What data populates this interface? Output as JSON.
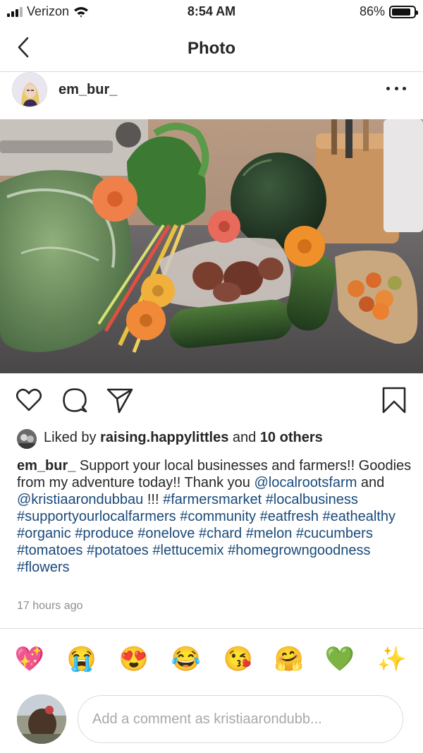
{
  "status": {
    "carrier": "Verizon",
    "time": "8:54 AM",
    "battery": "86%",
    "battery_level": 0.86
  },
  "nav": {
    "title": "Photo"
  },
  "post": {
    "username": "em_bur_",
    "likes": {
      "prefix": "Liked by ",
      "user": "raising.happylittles",
      "middle": " and ",
      "others": "10 others"
    },
    "caption": {
      "author": "em_bur_",
      "text1": " Support your local businesses and farmers!! Goodies from my adventure today!! Thank you ",
      "mention1": "@localrootsfarm",
      "text2": " and ",
      "mention2": "@kristiaarondubbau",
      "text3": " !!! ",
      "hashtags": [
        "#farmersmarket",
        "#localbusiness",
        "#supportyourlocalfarmers",
        "#community",
        "#eatfresh",
        "#eathealthy",
        "#organic",
        "#produce",
        "#onelove",
        "#chard",
        "#melon",
        "#cucumbers",
        "#tomatoes",
        "#potatoes",
        "#lettucemix",
        "#homegrowngoodness",
        "#flowers"
      ]
    },
    "timestamp": "17 hours ago"
  },
  "reactions": [
    "💖",
    "😭",
    "😍",
    "😂",
    "😘",
    "🤗",
    "💚",
    "✨"
  ],
  "comment": {
    "placeholder": "Add a comment as kristiaarondubb..."
  },
  "icons": {
    "back": "chevron-left-icon",
    "more": "more-horizontal-icon",
    "like": "heart-icon",
    "comment": "comment-icon",
    "share": "send-icon",
    "save": "bookmark-icon"
  },
  "colors": {
    "hashtag": "#1a4a7a",
    "secondary_text": "#8e8e8e",
    "divider": "#dbdbdb"
  }
}
